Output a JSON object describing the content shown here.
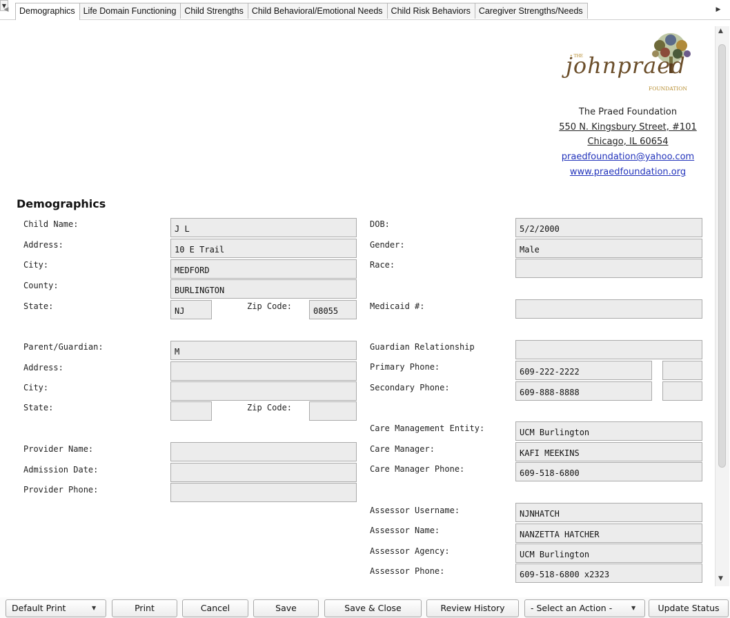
{
  "tabs": {
    "items": [
      {
        "label": "Demographics",
        "active": true
      },
      {
        "label": "Life Domain Functioning"
      },
      {
        "label": "Child Strengths"
      },
      {
        "label": "Child Behavioral/Emotional Needs"
      },
      {
        "label": "Child Risk Behaviors"
      },
      {
        "label": "Caregiver Strengths/Needs"
      }
    ],
    "scroll_left_icon": "chevron-left-icon",
    "scroll_right_icon": "chevron-right-icon",
    "overflow_icon": "chevron-down-icon"
  },
  "logo": {
    "the": "• THE",
    "wordmark": "johnpraed",
    "foundation": "FOUNDATION",
    "icon": "tree-icon"
  },
  "org": {
    "name": "The Praed Foundation",
    "street": "550 N. Kingsbury Street, #101",
    "city": "Chicago, IL 60654",
    "email": "praedfoundation@yahoo.com",
    "website": "www.praedfoundation.org"
  },
  "section_title": "Demographics",
  "child": {
    "name_label": "Child Name:",
    "name": "J L",
    "address_label": "Address:",
    "address": "10 E Trail",
    "city_label": "City:",
    "city": "MEDFORD",
    "county_label": "County:",
    "county": "BURLINGTON",
    "state_label": "State:",
    "state": "NJ",
    "zip_label": "Zip Code:",
    "zip": "08055",
    "dob_label": "DOB:",
    "dob": "5/2/2000",
    "gender_label": "Gender:",
    "gender": "Male",
    "race_label": "Race:",
    "race": "",
    "medicaid_label": "Medicaid #:",
    "medicaid": ""
  },
  "guardian": {
    "name_label": "Parent/Guardian:",
    "name": "M",
    "address_label": "Address:",
    "address": "",
    "city_label": "City:",
    "city": "",
    "state_label": "State:",
    "state": "",
    "zip_label": "Zip Code:",
    "zip": "",
    "relationship_label": "Guardian Relationship",
    "relationship": "",
    "primary_phone_label": "Primary Phone:",
    "primary_phone": "609-222-2222",
    "primary_ext": "",
    "secondary_phone_label": "Secondary Phone:",
    "secondary_phone": "609-888-8888",
    "secondary_ext": ""
  },
  "provider": {
    "name_label": "Provider Name:",
    "name": "",
    "admission_label": "Admission Date:",
    "admission": "",
    "phone_label": "Provider Phone:",
    "phone": ""
  },
  "care": {
    "entity_label": "Care Management Entity:",
    "entity": "UCM Burlington",
    "manager_label": "Care Manager:",
    "manager": "KAFI MEEKINS",
    "phone_label": "Care Manager Phone:",
    "phone": "609-518-6800"
  },
  "assessor": {
    "username_label": "Assessor Username:",
    "username": "NJNHATCH",
    "name_label": "Assessor Name:",
    "name": "NANZETTA HATCHER",
    "agency_label": "Assessor Agency:",
    "agency": "UCM Burlington",
    "phone_label": "Assessor Phone:",
    "phone": "609-518-6800 x2323"
  },
  "toolbar": {
    "default_print": "Default Print",
    "print": "Print",
    "cancel": "Cancel",
    "save": "Save",
    "save_close": "Save & Close",
    "review_history": "Review History",
    "select_action": "- Select an Action -",
    "update_status": "Update Status",
    "dropdown_icon": "caret-down-icon"
  }
}
